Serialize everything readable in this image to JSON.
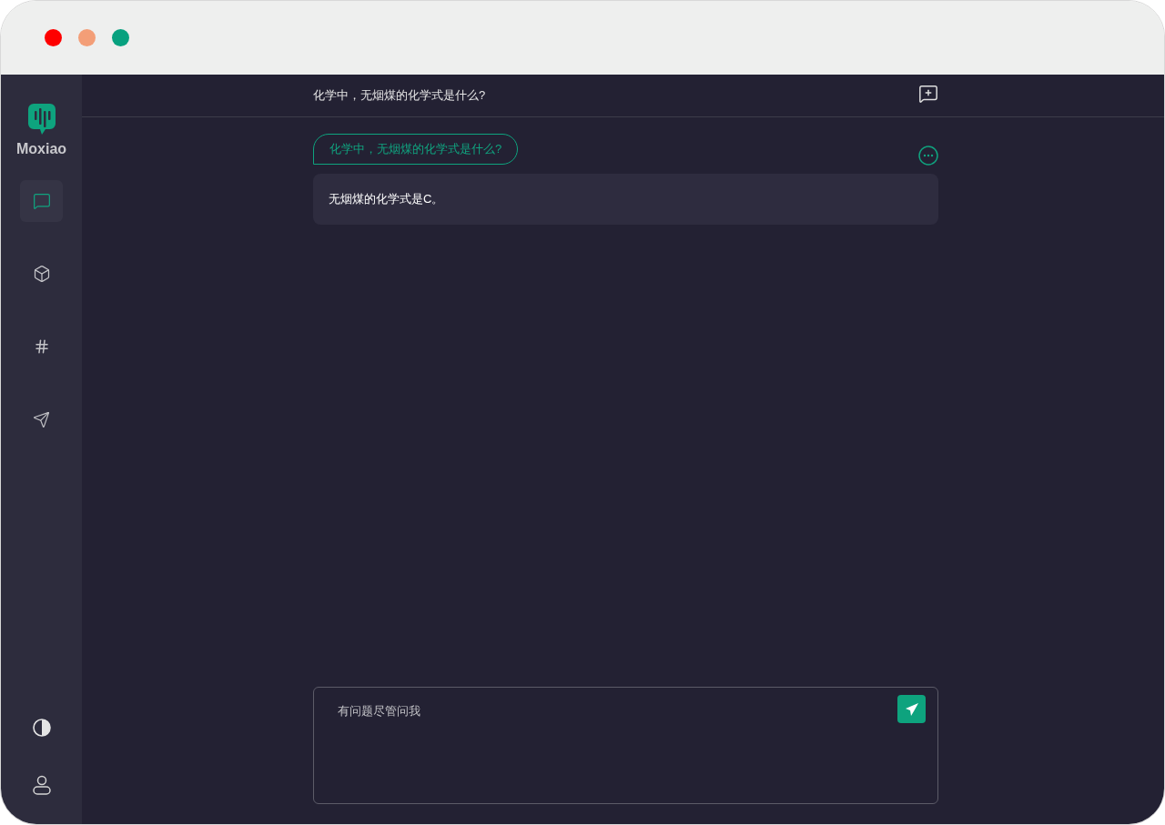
{
  "window": {
    "controls": [
      {
        "color": "#fe0000"
      },
      {
        "color": "#f39e77"
      },
      {
        "color": "#07a17f"
      }
    ]
  },
  "sidebar": {
    "logo": "Moxiao",
    "items": [
      {
        "kind": "chat",
        "selected": true
      },
      {
        "kind": "cube",
        "selected": false
      },
      {
        "kind": "hash",
        "selected": false
      },
      {
        "kind": "send",
        "selected": false
      }
    ],
    "bottom_items": [
      {
        "kind": "theme"
      },
      {
        "kind": "user"
      }
    ]
  },
  "header": {
    "title": "化学中，无烟煤的化学式是什么?"
  },
  "messages": [
    {
      "kind": "question",
      "text": "化学中，无烟煤的化学式是什么?"
    },
    {
      "kind": "answer",
      "text": "无烟煤的化学式是C。"
    }
  ],
  "composer": {
    "placeholder": "有问题尽管问我"
  }
}
